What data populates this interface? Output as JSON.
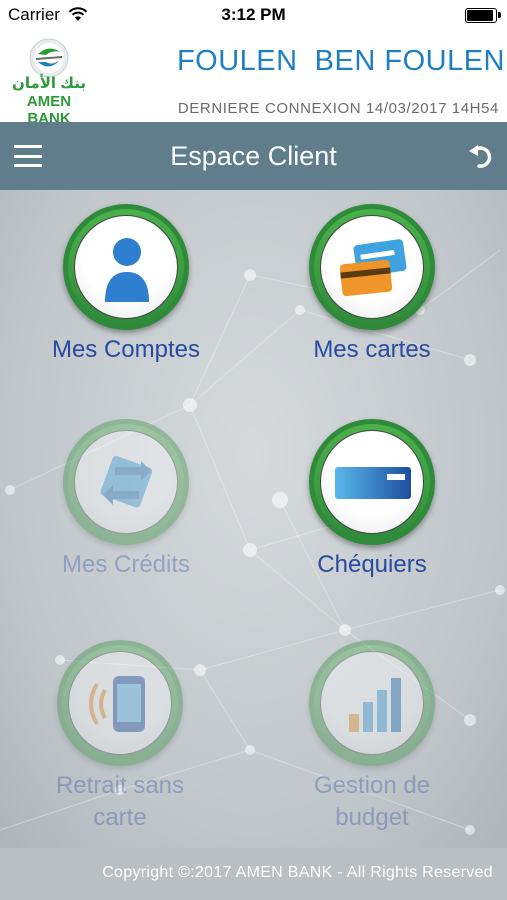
{
  "status_bar": {
    "carrier": "Carrier",
    "time": "3:12 PM",
    "battery_level": 1.0
  },
  "header": {
    "bank_name_arabic": "بنك الأمان",
    "bank_name": "AMEN BANK",
    "user_name": "FOULEN  BEN FOULEN",
    "last_login": "DERNIERE CONNEXION 14/03/2017 14H54"
  },
  "nav": {
    "title": "Espace Client",
    "menu_icon": "hamburger-icon",
    "back_icon": "undo-arrow-icon"
  },
  "tiles": [
    {
      "label": "Mes Comptes",
      "icon": "user-icon",
      "enabled": true
    },
    {
      "label": "Mes cartes",
      "icon": "cards-icon",
      "enabled": true
    },
    {
      "label": "Mes Crédits",
      "icon": "credit-icon",
      "enabled": false
    },
    {
      "label": "Chéquiers",
      "icon": "cheque-icon",
      "enabled": true
    },
    {
      "label": "Retrait sans carte",
      "line1": "Retrait sans",
      "line2": "carte",
      "icon": "phone-contactless-icon",
      "enabled": false
    },
    {
      "label": "Gestion de budget",
      "line1": "Gestion de",
      "line2": "budget",
      "icon": "bar-chart-icon",
      "enabled": false
    }
  ],
  "footer": {
    "copyright": "Copyright ©:2017 AMEN BANK - All Rights Reserved"
  },
  "colors": {
    "brand_green": "#2d9a3a",
    "title_blue": "#1f7fc4",
    "nav_bar": "#5f7d8b",
    "label_blue": "#2a4aa0"
  }
}
